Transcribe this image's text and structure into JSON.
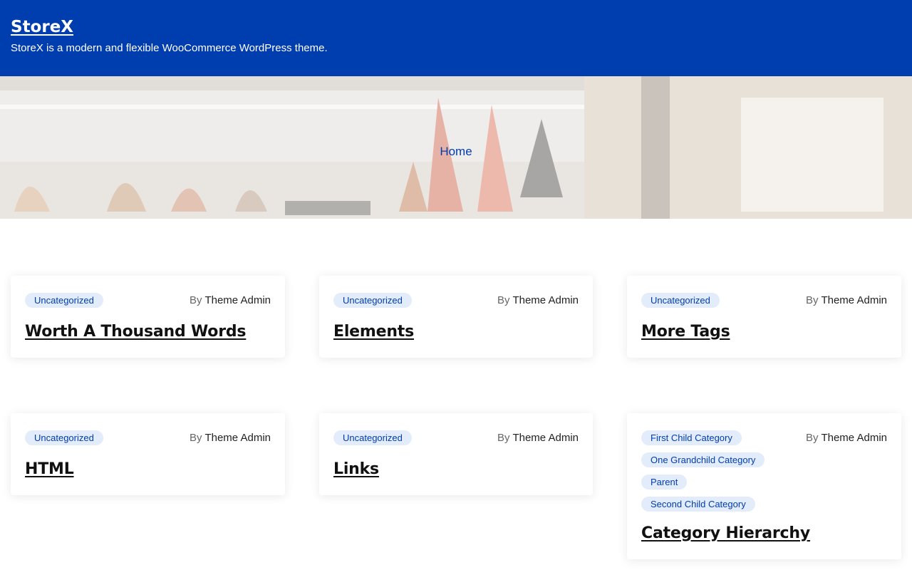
{
  "site": {
    "title": "StoreX",
    "tagline": "StoreX is a modern and flexible WooCommerce WordPress theme."
  },
  "hero": {
    "breadcrumb": "Home"
  },
  "posts": [
    {
      "categories": [
        "Uncategorized"
      ],
      "by_label": "By",
      "author": "Theme Admin",
      "title": "Worth A Thousand Words"
    },
    {
      "categories": [
        "Uncategorized"
      ],
      "by_label": "By",
      "author": "Theme Admin",
      "title": "Elements"
    },
    {
      "categories": [
        "Uncategorized"
      ],
      "by_label": "By",
      "author": "Theme Admin",
      "title": "More Tags"
    },
    {
      "categories": [
        "Uncategorized"
      ],
      "by_label": "By",
      "author": "Theme Admin",
      "title": "HTML"
    },
    {
      "categories": [
        "Uncategorized"
      ],
      "by_label": "By",
      "author": "Theme Admin",
      "title": "Links"
    },
    {
      "categories": [
        "First Child Category",
        "One Grandchild Category",
        "Parent",
        "Second Child Category"
      ],
      "by_label": "By",
      "author": "Theme Admin",
      "title": "Category Hierarchy"
    }
  ],
  "colors": {
    "header_bg": "#003DAF",
    "accent": "#003DAF",
    "badge_bg": "#E3ECFA"
  }
}
